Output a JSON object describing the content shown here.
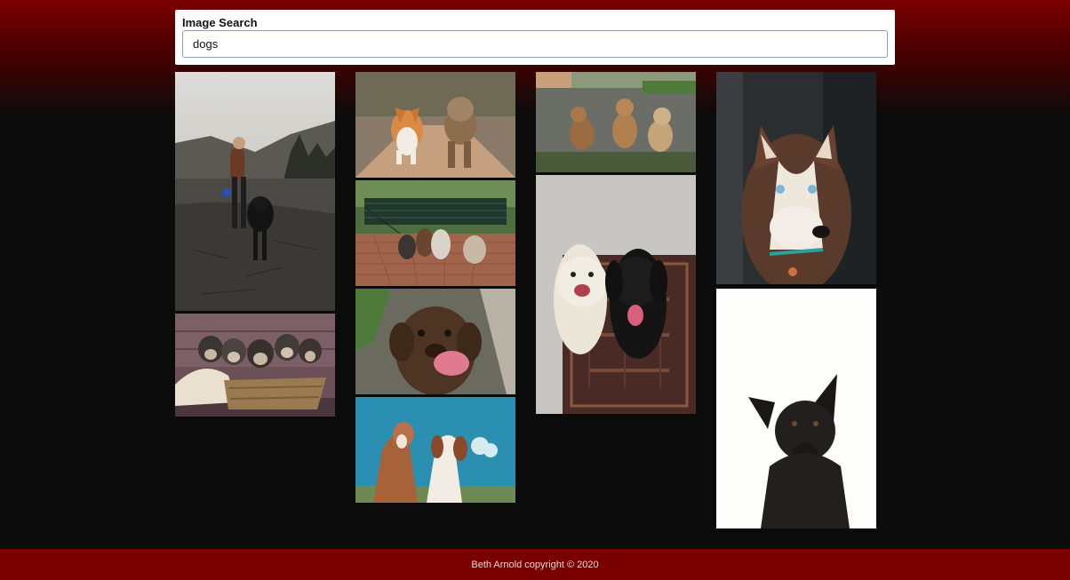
{
  "search": {
    "label": "Image Search",
    "value": "dogs"
  },
  "results": [
    {
      "name": "woman-walking-rottweiler",
      "col": 0
    },
    {
      "name": "puppies-in-basket",
      "col": 0
    },
    {
      "name": "corgi-and-yorkie",
      "col": 1
    },
    {
      "name": "dogs-on-leashes-park",
      "col": 1
    },
    {
      "name": "chocolate-lab-licking",
      "col": 1
    },
    {
      "name": "two-dogs-blue-sky",
      "col": 1
    },
    {
      "name": "three-puppies-gravel",
      "col": 2
    },
    {
      "name": "white-and-black-dogs-rug",
      "col": 2
    },
    {
      "name": "husky-portrait",
      "col": 3
    },
    {
      "name": "black-shepherd-white-bg",
      "col": 3
    }
  ],
  "footer": {
    "text": "Beth Arnold copyright © 2020"
  },
  "colors": {
    "brand": "#7a0000",
    "background": "#0b0b0b"
  }
}
